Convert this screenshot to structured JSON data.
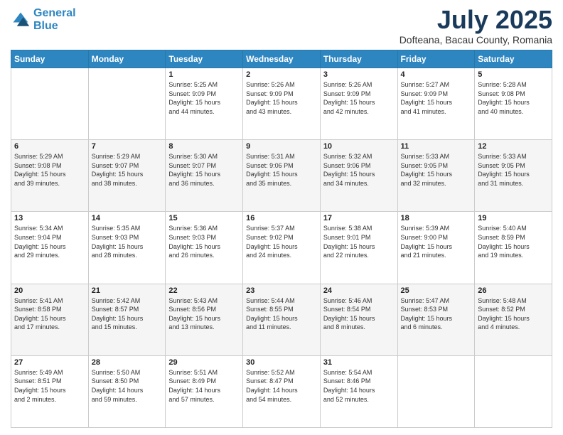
{
  "header": {
    "logo_line1": "General",
    "logo_line2": "Blue",
    "month": "July 2025",
    "location": "Dofteana, Bacau County, Romania"
  },
  "weekdays": [
    "Sunday",
    "Monday",
    "Tuesday",
    "Wednesday",
    "Thursday",
    "Friday",
    "Saturday"
  ],
  "weeks": [
    [
      {
        "day": "",
        "content": ""
      },
      {
        "day": "",
        "content": ""
      },
      {
        "day": "1",
        "content": "Sunrise: 5:25 AM\nSunset: 9:09 PM\nDaylight: 15 hours\nand 44 minutes."
      },
      {
        "day": "2",
        "content": "Sunrise: 5:26 AM\nSunset: 9:09 PM\nDaylight: 15 hours\nand 43 minutes."
      },
      {
        "day": "3",
        "content": "Sunrise: 5:26 AM\nSunset: 9:09 PM\nDaylight: 15 hours\nand 42 minutes."
      },
      {
        "day": "4",
        "content": "Sunrise: 5:27 AM\nSunset: 9:09 PM\nDaylight: 15 hours\nand 41 minutes."
      },
      {
        "day": "5",
        "content": "Sunrise: 5:28 AM\nSunset: 9:08 PM\nDaylight: 15 hours\nand 40 minutes."
      }
    ],
    [
      {
        "day": "6",
        "content": "Sunrise: 5:29 AM\nSunset: 9:08 PM\nDaylight: 15 hours\nand 39 minutes."
      },
      {
        "day": "7",
        "content": "Sunrise: 5:29 AM\nSunset: 9:07 PM\nDaylight: 15 hours\nand 38 minutes."
      },
      {
        "day": "8",
        "content": "Sunrise: 5:30 AM\nSunset: 9:07 PM\nDaylight: 15 hours\nand 36 minutes."
      },
      {
        "day": "9",
        "content": "Sunrise: 5:31 AM\nSunset: 9:06 PM\nDaylight: 15 hours\nand 35 minutes."
      },
      {
        "day": "10",
        "content": "Sunrise: 5:32 AM\nSunset: 9:06 PM\nDaylight: 15 hours\nand 34 minutes."
      },
      {
        "day": "11",
        "content": "Sunrise: 5:33 AM\nSunset: 9:05 PM\nDaylight: 15 hours\nand 32 minutes."
      },
      {
        "day": "12",
        "content": "Sunrise: 5:33 AM\nSunset: 9:05 PM\nDaylight: 15 hours\nand 31 minutes."
      }
    ],
    [
      {
        "day": "13",
        "content": "Sunrise: 5:34 AM\nSunset: 9:04 PM\nDaylight: 15 hours\nand 29 minutes."
      },
      {
        "day": "14",
        "content": "Sunrise: 5:35 AM\nSunset: 9:03 PM\nDaylight: 15 hours\nand 28 minutes."
      },
      {
        "day": "15",
        "content": "Sunrise: 5:36 AM\nSunset: 9:03 PM\nDaylight: 15 hours\nand 26 minutes."
      },
      {
        "day": "16",
        "content": "Sunrise: 5:37 AM\nSunset: 9:02 PM\nDaylight: 15 hours\nand 24 minutes."
      },
      {
        "day": "17",
        "content": "Sunrise: 5:38 AM\nSunset: 9:01 PM\nDaylight: 15 hours\nand 22 minutes."
      },
      {
        "day": "18",
        "content": "Sunrise: 5:39 AM\nSunset: 9:00 PM\nDaylight: 15 hours\nand 21 minutes."
      },
      {
        "day": "19",
        "content": "Sunrise: 5:40 AM\nSunset: 8:59 PM\nDaylight: 15 hours\nand 19 minutes."
      }
    ],
    [
      {
        "day": "20",
        "content": "Sunrise: 5:41 AM\nSunset: 8:58 PM\nDaylight: 15 hours\nand 17 minutes."
      },
      {
        "day": "21",
        "content": "Sunrise: 5:42 AM\nSunset: 8:57 PM\nDaylight: 15 hours\nand 15 minutes."
      },
      {
        "day": "22",
        "content": "Sunrise: 5:43 AM\nSunset: 8:56 PM\nDaylight: 15 hours\nand 13 minutes."
      },
      {
        "day": "23",
        "content": "Sunrise: 5:44 AM\nSunset: 8:55 PM\nDaylight: 15 hours\nand 11 minutes."
      },
      {
        "day": "24",
        "content": "Sunrise: 5:46 AM\nSunset: 8:54 PM\nDaylight: 15 hours\nand 8 minutes."
      },
      {
        "day": "25",
        "content": "Sunrise: 5:47 AM\nSunset: 8:53 PM\nDaylight: 15 hours\nand 6 minutes."
      },
      {
        "day": "26",
        "content": "Sunrise: 5:48 AM\nSunset: 8:52 PM\nDaylight: 15 hours\nand 4 minutes."
      }
    ],
    [
      {
        "day": "27",
        "content": "Sunrise: 5:49 AM\nSunset: 8:51 PM\nDaylight: 15 hours\nand 2 minutes."
      },
      {
        "day": "28",
        "content": "Sunrise: 5:50 AM\nSunset: 8:50 PM\nDaylight: 14 hours\nand 59 minutes."
      },
      {
        "day": "29",
        "content": "Sunrise: 5:51 AM\nSunset: 8:49 PM\nDaylight: 14 hours\nand 57 minutes."
      },
      {
        "day": "30",
        "content": "Sunrise: 5:52 AM\nSunset: 8:47 PM\nDaylight: 14 hours\nand 54 minutes."
      },
      {
        "day": "31",
        "content": "Sunrise: 5:54 AM\nSunset: 8:46 PM\nDaylight: 14 hours\nand 52 minutes."
      },
      {
        "day": "",
        "content": ""
      },
      {
        "day": "",
        "content": ""
      }
    ]
  ]
}
